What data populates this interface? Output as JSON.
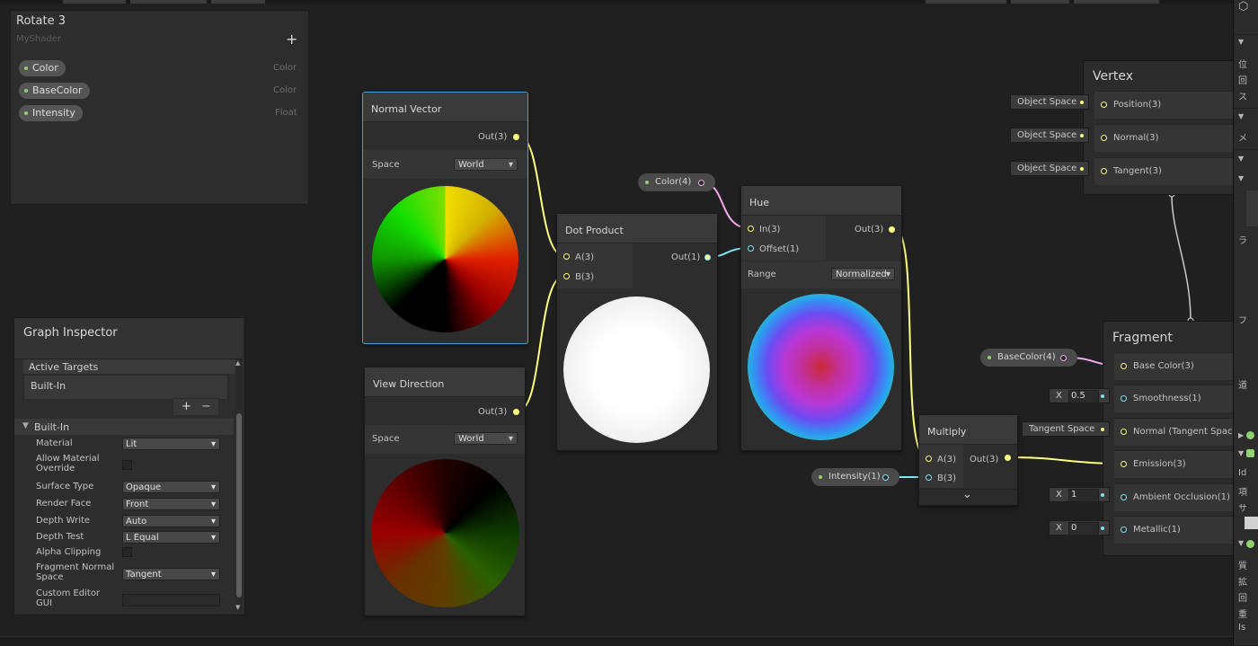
{
  "blackboard": {
    "title": "Rotate 3",
    "subtitle": "MyShader",
    "add_label": "+",
    "properties": [
      {
        "name": "Color",
        "type": "Color"
      },
      {
        "name": "BaseColor",
        "type": "Color"
      },
      {
        "name": "Intensity",
        "type": "Float"
      }
    ]
  },
  "inspector": {
    "title": "Graph Inspector",
    "active_targets_label": "Active Targets",
    "target_item": "Built-In",
    "add_label": "+",
    "remove_label": "−",
    "section_label": "Built-In",
    "rows": [
      {
        "label": "Material",
        "kind": "dropdown",
        "value": "Lit"
      },
      {
        "label": "Allow Material Override",
        "kind": "checkbox",
        "value": ""
      },
      {
        "label": "Surface Type",
        "kind": "dropdown",
        "value": "Opaque"
      },
      {
        "label": "Render Face",
        "kind": "dropdown",
        "value": "Front"
      },
      {
        "label": "Depth Write",
        "kind": "dropdown",
        "value": "Auto"
      },
      {
        "label": "Depth Test",
        "kind": "dropdown",
        "value": "L Equal"
      },
      {
        "label": "Alpha Clipping",
        "kind": "checkbox",
        "value": ""
      },
      {
        "label": "Fragment Normal Space",
        "kind": "dropdown",
        "value": "Tangent"
      },
      {
        "label": "Custom Editor GUI",
        "kind": "text",
        "value": ""
      }
    ]
  },
  "nodes": {
    "normal_vector": {
      "title": "Normal Vector",
      "out": "Out(3)",
      "space_label": "Space",
      "space_value": "World"
    },
    "view_direction": {
      "title": "View Direction",
      "out": "Out(3)",
      "space_label": "Space",
      "space_value": "World"
    },
    "dot_product": {
      "title": "Dot Product",
      "in_a": "A(3)",
      "in_b": "B(3)",
      "out": "Out(1)"
    },
    "hue": {
      "title": "Hue",
      "in_in": "In(3)",
      "in_offset": "Offset(1)",
      "out": "Out(3)",
      "range_label": "Range",
      "range_value": "Normalized"
    },
    "multiply": {
      "title": "Multiply",
      "in_a": "A(3)",
      "in_b": "B(3)",
      "out": "Out(3)",
      "expand": "⌄"
    },
    "color_prop": {
      "label": "Color(4)"
    },
    "intensity_prop": {
      "label": "Intensity(1)"
    },
    "basecolor_prop": {
      "label": "BaseColor(4)"
    }
  },
  "vertex": {
    "title": "Vertex",
    "slots": [
      {
        "input": "Object Space",
        "label": "Position(3)"
      },
      {
        "input": "Object Space",
        "label": "Normal(3)"
      },
      {
        "input": "Object Space",
        "label": "Tangent(3)"
      }
    ]
  },
  "fragment": {
    "title": "Fragment",
    "slots": [
      {
        "label": "Base Color(3)"
      },
      {
        "label": "Smoothness(1)",
        "x_label": "X",
        "x_value": "0.5"
      },
      {
        "label": "Normal (Tangent Space)",
        "input": "Tangent Space"
      },
      {
        "label": "Emission(3)"
      },
      {
        "label": "Ambient Occlusion(1)",
        "x_label": "X",
        "x_value": "1"
      },
      {
        "label": "Metallic(1)",
        "x_label": "X",
        "x_value": "0"
      }
    ]
  },
  "right_panel": {
    "rows": [
      "位",
      "回",
      "ス",
      "メ",
      "ラ",
      "フ",
      "道",
      "Id",
      "項",
      "サ",
      "質",
      "拡",
      "回",
      "重",
      "Is"
    ]
  },
  "colors": {
    "vector3": "#ffff80",
    "vector1": "#84e4f4",
    "vector4": "#f1a8ee",
    "selection": "#4aa3d8"
  }
}
